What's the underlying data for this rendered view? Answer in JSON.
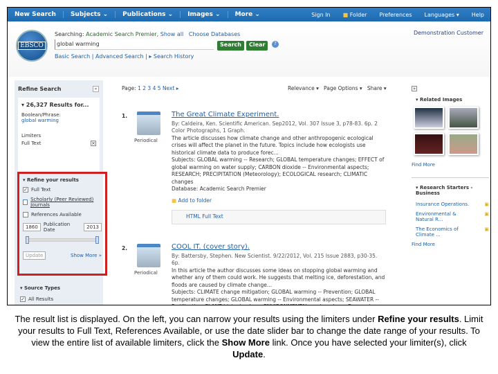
{
  "nav": {
    "items": [
      "New Search",
      "Subjects ⌄",
      "Publications ⌄",
      "Images ⌄",
      "More ⌄"
    ],
    "right": [
      "Sign In",
      "Folder",
      "Preferences",
      "Languages ▾",
      "Help"
    ]
  },
  "header": {
    "logo": "EBSCO",
    "searching_label": "Searching:",
    "database": "Academic Search Premier,",
    "show_all": "Show all",
    "choose": "Choose Databases",
    "query": "global warming",
    "search_btn": "Search",
    "clear_btn": "Clear",
    "basic": "Basic Search",
    "advanced": "Advanced Search",
    "history": "▸ Search History",
    "customer": "Demonstration Customer"
  },
  "left": {
    "title": "Refine Search",
    "results_for": "▾ 26,327 Results for...",
    "boolean_label": "Boolean/Phrase:",
    "boolean_value": "global warming",
    "limiters_label": "Limiters",
    "limiter_value": "Full Text",
    "refine_title": "▾ Refine your results",
    "full_text": "Full Text",
    "scholarly": "Scholarly (Peer Reviewed) Journals",
    "references": "References Available",
    "from_year": "1860",
    "date_label": "Publication Date",
    "to_year": "2013",
    "update": "Update",
    "show_more": "Show More »",
    "source_types": "▾ Source Types",
    "all_results": "All Results"
  },
  "main": {
    "pages_label": "Page:",
    "pages": [
      "1",
      "2",
      "3",
      "4",
      "5"
    ],
    "next": "Next ▸",
    "sort": "Relevance ▾",
    "page_options": "Page Options ▾",
    "share": "Share ▾",
    "results": [
      {
        "num": "1.",
        "type": "Periodical",
        "title": "The Great Climate Experiment.",
        "by": "By: Caldeira, Ken. Scientific American. Sep2012, Vol. 307 Issue 3, p78-83. 6p. 2 Color Photographs, 1 Graph.",
        "abstract": "The article discusses how climate change and other anthropogenic ecological crises will affect the planet in the future. Topics include how ecologists use historical climate data to produce forec...",
        "subjects": "Subjects: GLOBAL warming -- Research; GLOBAL temperature changes; EFFECT of global warming on water supply; CARBON dioxide -- Environmental aspects; RESEARCH; PRECIPITATION (Meteorology); ECOLOGICAL research; CLIMATIC changes",
        "database": "Database: Academic Search Premier",
        "add_folder": "Add to folder",
        "full_text": "HTML Full Text"
      },
      {
        "num": "2.",
        "type": "Periodical",
        "title": "COOL IT. (cover story).",
        "by": "By: Battersby, Stephen. New Scientist. 9/22/2012, Vol. 215 Issue 2883, p30-35. 6p.",
        "abstract": "In this article the author discusses some ideas on stopping global warming and whether any of them could work. He suggests that melting ice, deforestation, and floods are caused by climate change...",
        "subjects": "Subjects: CLIMATE change mitigation; GLOBAL warming -- Prevention; GLOBAL temperature changes; GLOBAL warming -- Environmental aspects; SEAWATER -- Fertilization; PLANT biotechnology; ENVIRONMENTAL engineering -- Economic aspects; Research and Development in Biotechnology"
      }
    ]
  },
  "right": {
    "related_images": "▾ Related Images",
    "find_more": "Find More",
    "starters": "▾ Research Starters - Business",
    "starter_items": [
      "Insurance Operations.",
      "Environmental & Natural R...",
      "The Economics of Climate ..."
    ],
    "find_more2": "Find More"
  },
  "caption": {
    "p1": "The result list is displayed. On the left, you can narrow your results using the limiters under ",
    "b1": "Refine your results",
    "p2": ". Limit your results to Full Text, References Available, or use the date slider bar to change the date range of your results. To view the entire list of available limiters, click the ",
    "b2": "Show More",
    "p3": " link. Once you have selected your limiter(s), click ",
    "b3": "Update",
    "p4": "."
  },
  "colors": {
    "nav": "#1e6ab0",
    "highlight": "#d01f1f",
    "button": "#2e7d32",
    "link": "#1e5fa8"
  }
}
